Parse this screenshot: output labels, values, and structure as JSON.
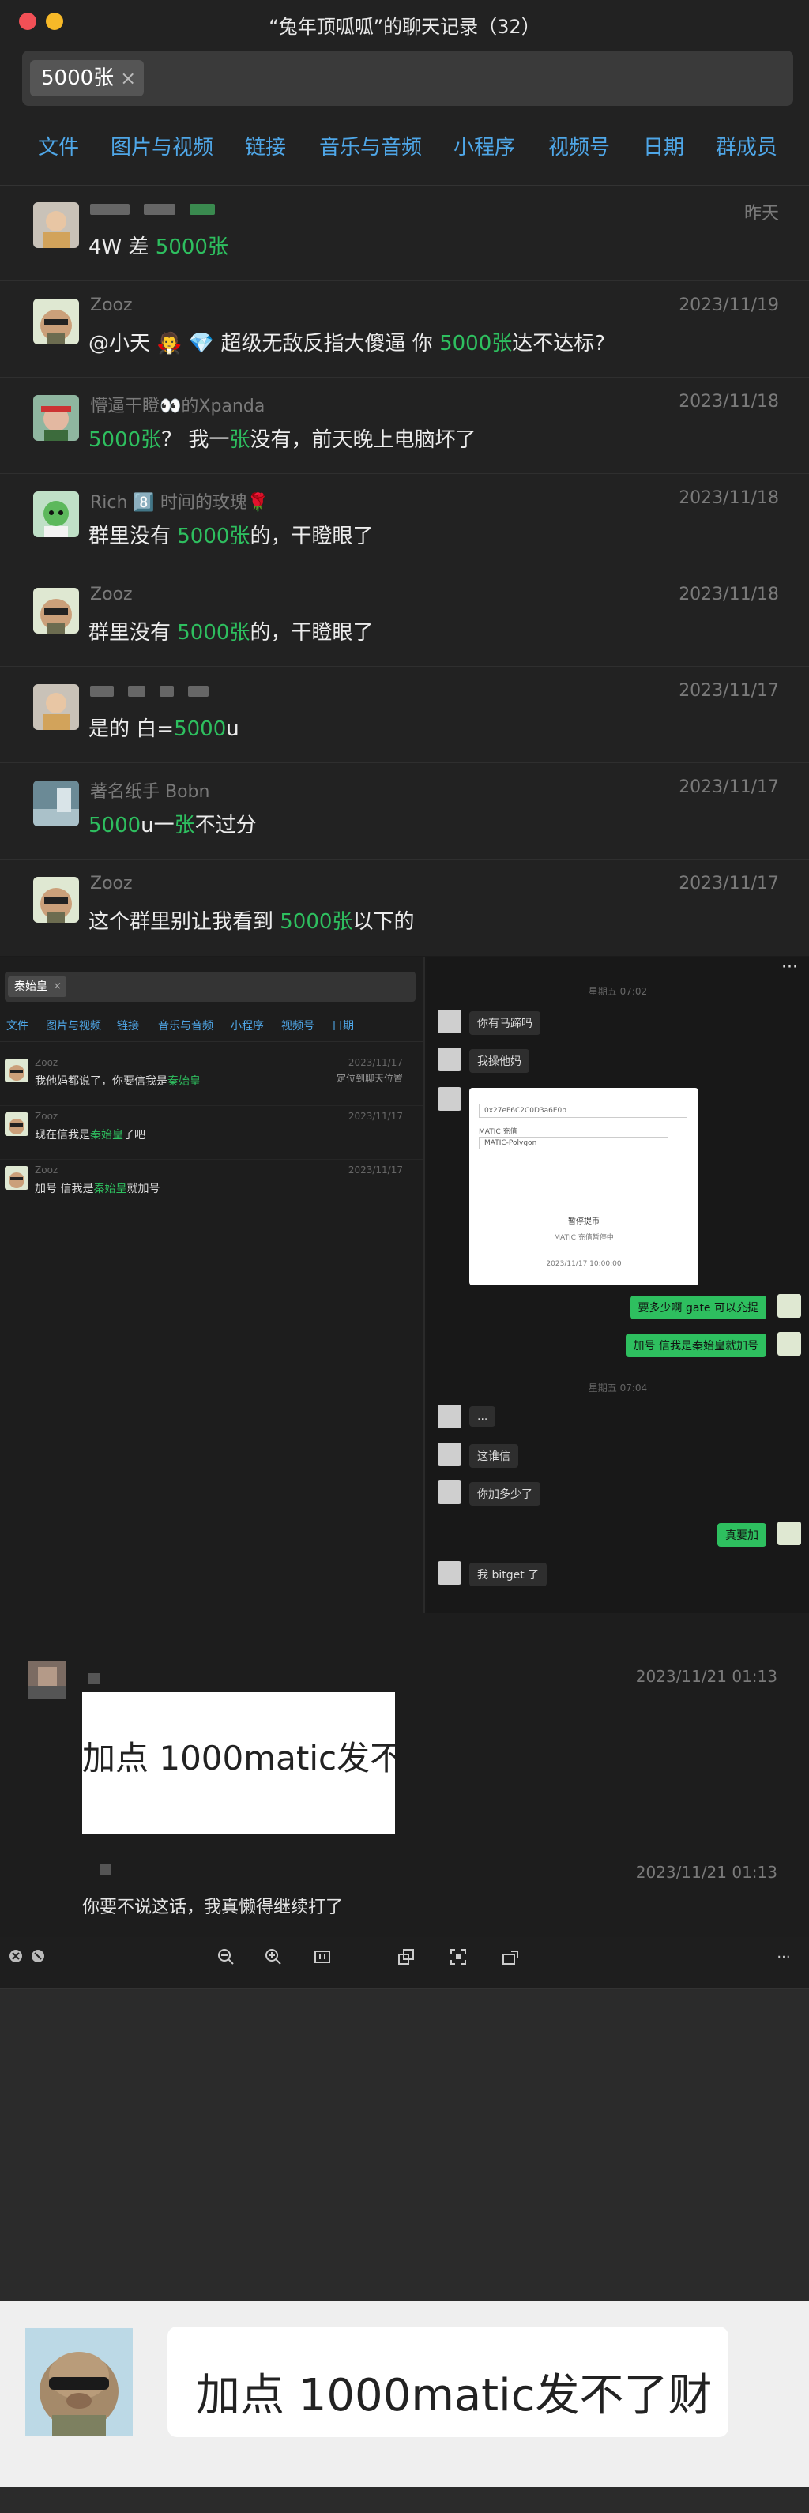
{
  "window": {
    "title": "“兔年顶呱呱”的聊天记录（32）"
  },
  "search": {
    "chip": "5000张",
    "clear": "×"
  },
  "tabs": [
    "文件",
    "图片与视频",
    "链接",
    "音乐与音频",
    "小程序",
    "视频号",
    "日期",
    "群成员"
  ],
  "messages": [
    {
      "name": "",
      "date": "昨天",
      "parts": [
        "4W 差 ",
        "5000张",
        ""
      ]
    },
    {
      "name": "Zooz",
      "date": "2023/11/19",
      "parts": [
        "@小天 🧛 💎 超级无敌反指大傻逼 你 ",
        "5000张",
        "达不达标?"
      ]
    },
    {
      "name": "懵逼干瞪👀的Xpanda",
      "date": "2023/11/18",
      "parts": [
        "",
        "5000张",
        "？ 我一",
        "张",
        "没有，前天晚上电脑坏了"
      ]
    },
    {
      "name": "Rich 8️⃣  时间的玫瑰🌹",
      "date": "2023/11/18",
      "parts": [
        "群里没有 ",
        "5000张",
        "的，干瞪眼了"
      ]
    },
    {
      "name": "Zooz",
      "date": "2023/11/18",
      "parts": [
        "群里没有 ",
        "5000张",
        "的，干瞪眼了"
      ]
    },
    {
      "name": "",
      "date": "2023/11/17",
      "parts": [
        "是的 白=",
        "5000",
        "u"
      ]
    },
    {
      "name": "著名纸手 Bobn",
      "date": "2023/11/17",
      "parts": [
        "",
        "5000",
        "u一",
        "张",
        "不过分"
      ]
    },
    {
      "name": "Zooz",
      "date": "2023/11/17",
      "parts": [
        "这个群里别让我看到 ",
        "5000张",
        "以下的"
      ]
    }
  ],
  "second": {
    "chip": "秦始皇",
    "tabs": [
      "文件",
      "图片与视频",
      "链接",
      "音乐与音频",
      "小程序",
      "视频号",
      "日期"
    ],
    "messages": [
      {
        "name": "Zooz",
        "date": "2023/11/17",
        "extra": "定位到聊天位置",
        "parts": [
          "我他妈都说了，你要信我是",
          "秦始皇",
          ""
        ]
      },
      {
        "name": "Zooz",
        "date": "2023/11/17",
        "extra": "",
        "parts": [
          "现在信我是",
          "秦始皇",
          "了吧"
        ]
      },
      {
        "name": "Zooz",
        "date": "2023/11/17",
        "extra": "",
        "parts": [
          "加号 信我是",
          "秦始皇",
          "就加号"
        ]
      }
    ],
    "chat": {
      "time1": "星期五 07:02",
      "time2": "星期五 07:04",
      "left1": [
        "你有马蹄吗",
        "我操他妈"
      ],
      "card": {
        "title": "MATIC 充值",
        "subtitle": "MATIC-Polygon",
        "state": "暂停提币",
        "note": "MATIC 充值暂停中",
        "date": "2023/11/17 10:00:00"
      },
      "right1": [
        "要多少啊 gate 可以充提",
        "加号 信我是秦始皇就加号"
      ],
      "left2": [
        "...",
        "这谁信",
        "你加多少了"
      ],
      "right2": [
        "真要加"
      ],
      "left3": [
        "我 bitget 了"
      ]
    }
  },
  "detail": {
    "date1": "2023/11/21 01:13",
    "image_text": "加点 1000matic发不",
    "date2": "2023/11/21 01:13",
    "text": "你要不说这话，我真懒得继续打了"
  },
  "viewer": {
    "more": "···",
    "zoom_text": "加点 1000matic发不了财"
  },
  "colors": {
    "highlight": "#2ebf5f",
    "tab": "#4fa7e8",
    "bubble_self": "#2ebf5f"
  }
}
